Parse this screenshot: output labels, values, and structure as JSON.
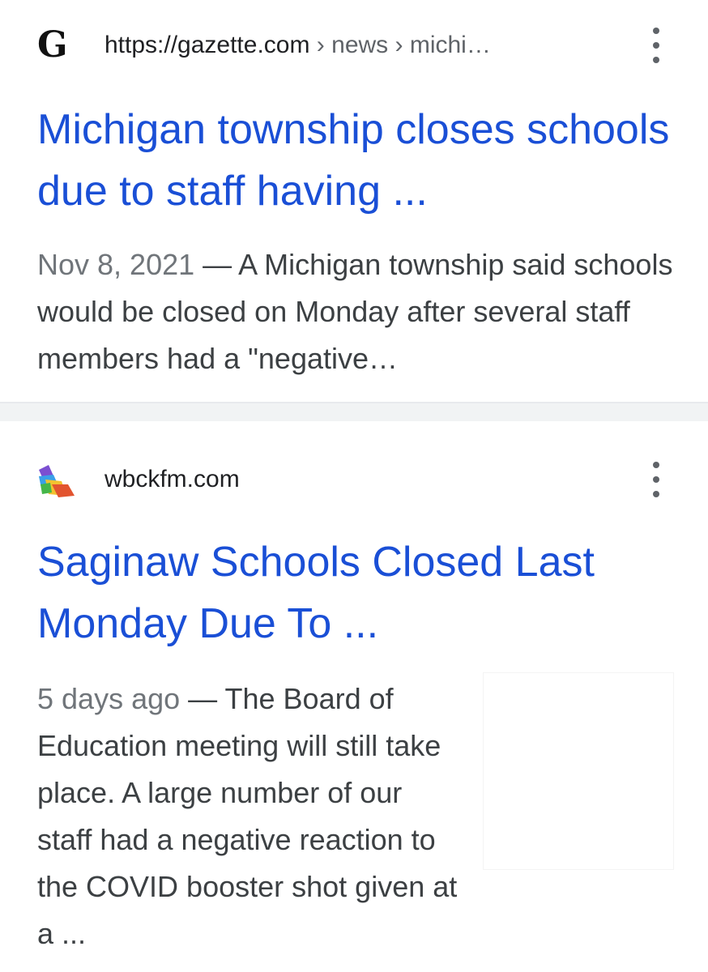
{
  "results": [
    {
      "favicon": "gazette-logo",
      "favicon_glyph": "G",
      "source_host": "https://gazette.com",
      "source_path": " › news › michi…",
      "menu_icon": "more-vert-icon",
      "title": "Michigan township closes schools due to staff having ...",
      "date": "Nov 8, 2021",
      "snippet": " — A Michigan township said schools would be closed on Monday after several staff members had a \"negative…"
    },
    {
      "favicon": "wbckfm-logo",
      "source_host": "wbckfm.com",
      "menu_icon": "more-vert-icon",
      "title": "Saginaw Schools Closed Last Monday Due To ...",
      "date": "5 days ago",
      "snippet": " — The Board of Education meeting will still take place. A large number of our staff had a negative reaction to the COVID booster shot given at a ..."
    }
  ],
  "colors": {
    "title_link": "#1a4fd6",
    "snippet_text": "#3c4043",
    "meta_text": "#70757a",
    "divider": "#f1f3f4"
  }
}
